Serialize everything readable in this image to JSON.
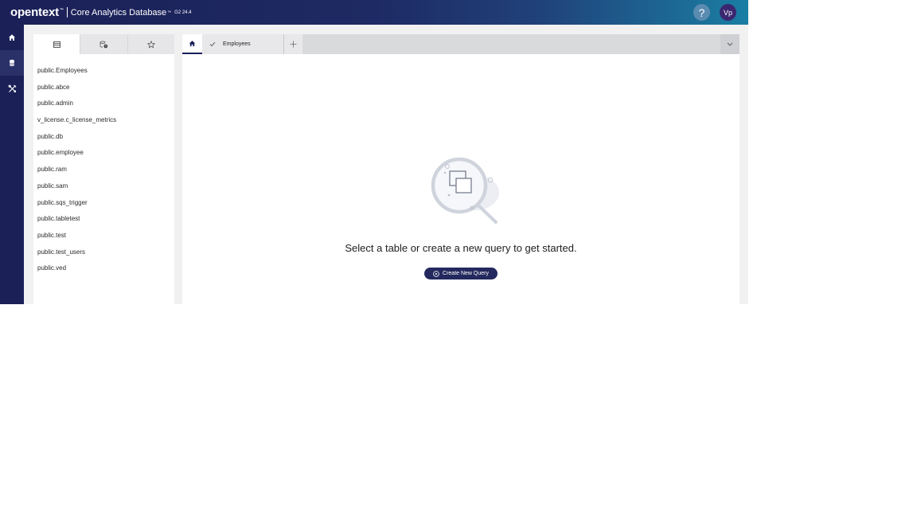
{
  "header": {
    "logo": "opentext",
    "logo_tm": "™",
    "product": "Core Analytics Database",
    "product_tm": "™",
    "version": "G2 24.4",
    "help_label": "?",
    "avatar_initials": "Vp"
  },
  "leftnav": {
    "items": [
      {
        "icon": "home-icon"
      },
      {
        "icon": "database-icon",
        "active": true
      },
      {
        "icon": "tools-icon"
      }
    ]
  },
  "panel": {
    "tabs": [
      {
        "icon": "table-list-icon",
        "active": true
      },
      {
        "icon": "history-icon"
      },
      {
        "icon": "star-icon"
      }
    ],
    "tables": [
      "public.Employees",
      "public.abce",
      "public.admin",
      "v_license.c_license_metrics",
      "public.db",
      "public.employee",
      "public.ram",
      "public.sam",
      "public.sqs_trigger",
      "public.tabletest",
      "public.test",
      "public.test_users",
      "public.ved"
    ]
  },
  "main": {
    "tabs": [
      {
        "icon": "home-icon",
        "active": true
      },
      {
        "label": "Employees",
        "icon": "check-icon"
      }
    ],
    "empty_state": {
      "title": "Select a table or create a new query to get started.",
      "button_label": "Create New Query"
    }
  }
}
